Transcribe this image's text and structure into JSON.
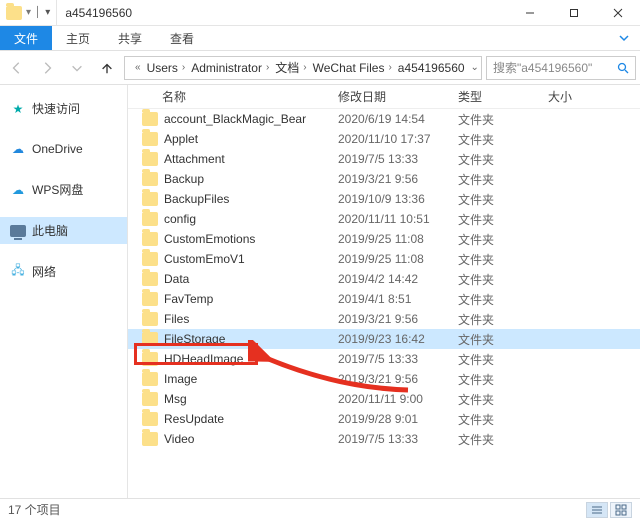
{
  "window": {
    "title": "a454196560",
    "minimize_tip": "Minimize",
    "maximize_tip": "Maximize",
    "close_tip": "Close"
  },
  "menu": {
    "file": "文件",
    "home": "主页",
    "share": "共享",
    "view": "查看"
  },
  "breadcrumb": {
    "segs": [
      "Users",
      "Administrator",
      "文档",
      "WeChat Files",
      "a454196560"
    ]
  },
  "search": {
    "placeholder": "搜索\"a454196560\""
  },
  "sidebar": {
    "items": [
      {
        "label": "快速访问",
        "icon": "star"
      },
      {
        "label": "OneDrive",
        "icon": "cloud"
      },
      {
        "label": "WPS网盘",
        "icon": "wps"
      },
      {
        "label": "此电脑",
        "icon": "pc",
        "selected": true
      },
      {
        "label": "网络",
        "icon": "net"
      }
    ]
  },
  "columns": {
    "name": "名称",
    "date": "修改日期",
    "type": "类型",
    "size": "大小"
  },
  "rows": [
    {
      "name": "account_BlackMagic_Bear",
      "date": "2020/6/19 14:54",
      "type": "文件夹"
    },
    {
      "name": "Applet",
      "date": "2020/11/10 17:37",
      "type": "文件夹"
    },
    {
      "name": "Attachment",
      "date": "2019/7/5 13:33",
      "type": "文件夹"
    },
    {
      "name": "Backup",
      "date": "2019/3/21 9:56",
      "type": "文件夹"
    },
    {
      "name": "BackupFiles",
      "date": "2019/10/9 13:36",
      "type": "文件夹"
    },
    {
      "name": "config",
      "date": "2020/11/11 10:51",
      "type": "文件夹"
    },
    {
      "name": "CustomEmotions",
      "date": "2019/9/25 11:08",
      "type": "文件夹"
    },
    {
      "name": "CustomEmoV1",
      "date": "2019/9/25 11:08",
      "type": "文件夹"
    },
    {
      "name": "Data",
      "date": "2019/4/2 14:42",
      "type": "文件夹"
    },
    {
      "name": "FavTemp",
      "date": "2019/4/1 8:51",
      "type": "文件夹"
    },
    {
      "name": "Files",
      "date": "2019/3/21 9:56",
      "type": "文件夹"
    },
    {
      "name": "FileStorage",
      "date": "2019/9/23 16:42",
      "type": "文件夹",
      "selected": true,
      "highlighted": true
    },
    {
      "name": "HDHeadImage",
      "date": "2019/7/5 13:33",
      "type": "文件夹"
    },
    {
      "name": "Image",
      "date": "2019/3/21 9:56",
      "type": "文件夹"
    },
    {
      "name": "Msg",
      "date": "2020/11/11 9:00",
      "type": "文件夹"
    },
    {
      "name": "ResUpdate",
      "date": "2019/9/28 9:01",
      "type": "文件夹"
    },
    {
      "name": "Video",
      "date": "2019/7/5 13:33",
      "type": "文件夹"
    }
  ],
  "status": {
    "item_count": "17 个项目"
  },
  "annotation": {
    "color": "#e53020"
  }
}
